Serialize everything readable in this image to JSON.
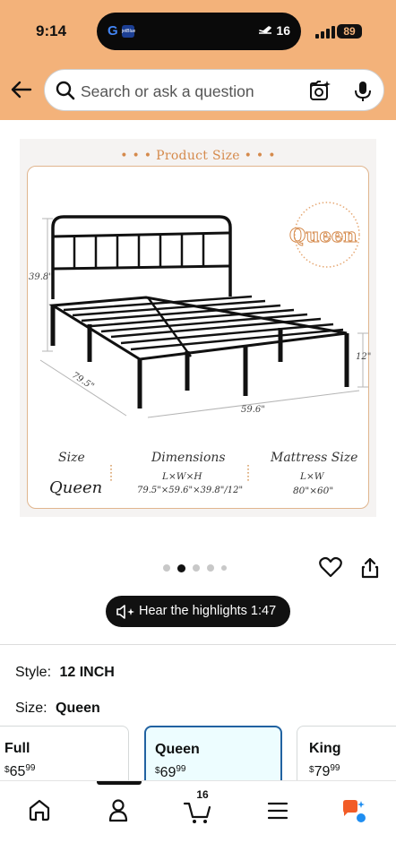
{
  "status_bar": {
    "time": "9:14",
    "island_left": "G",
    "island_brand": "jetBlue",
    "flight_count": "16",
    "battery": "89"
  },
  "header": {
    "search_placeholder": "Search or ask a question"
  },
  "product_image": {
    "title": "• • • Product Size • • •",
    "size_badge": "Queen",
    "dim_height": "39.8\"",
    "dim_length": "79.5\"",
    "dim_width": "59.6\"",
    "dim_clearance": "12\"",
    "col_size_label": "Size",
    "col_size_value": "Queen",
    "col_dims_label": "Dimensions",
    "col_dims_sub": "L×W×H",
    "col_dims_value": "79.5\"×59.6\"×39.8\"/12\"",
    "col_mattress_label": "Mattress Size",
    "col_mattress_sub": "L×W",
    "col_mattress_value": "80\"×60\""
  },
  "carousel": {
    "dot_count": 5,
    "active_dot": 1
  },
  "highlights": {
    "label": "Hear the highlights 1:47"
  },
  "style": {
    "label": "Style:",
    "value": "12 INCH"
  },
  "size": {
    "label": "Size:",
    "value": "Queen"
  },
  "size_options": [
    {
      "name": "Full",
      "currency": "$",
      "whole": "65",
      "fraction": "99",
      "selected": false
    },
    {
      "name": "Queen",
      "currency": "$",
      "whole": "69",
      "fraction": "99",
      "selected": true
    },
    {
      "name": "King",
      "currency": "$",
      "whole": "79",
      "fraction": "99",
      "selected": false
    }
  ],
  "bottom_nav": {
    "cart_count": "16",
    "items": [
      "home-icon",
      "account-icon",
      "cart-icon",
      "menu-icon",
      "rufus-icon"
    ]
  },
  "colors": {
    "header_bg": "#f3b27a",
    "accent_orange": "#d58a4c",
    "selected_border": "#2162a1",
    "selected_bg": "#edfdff"
  }
}
